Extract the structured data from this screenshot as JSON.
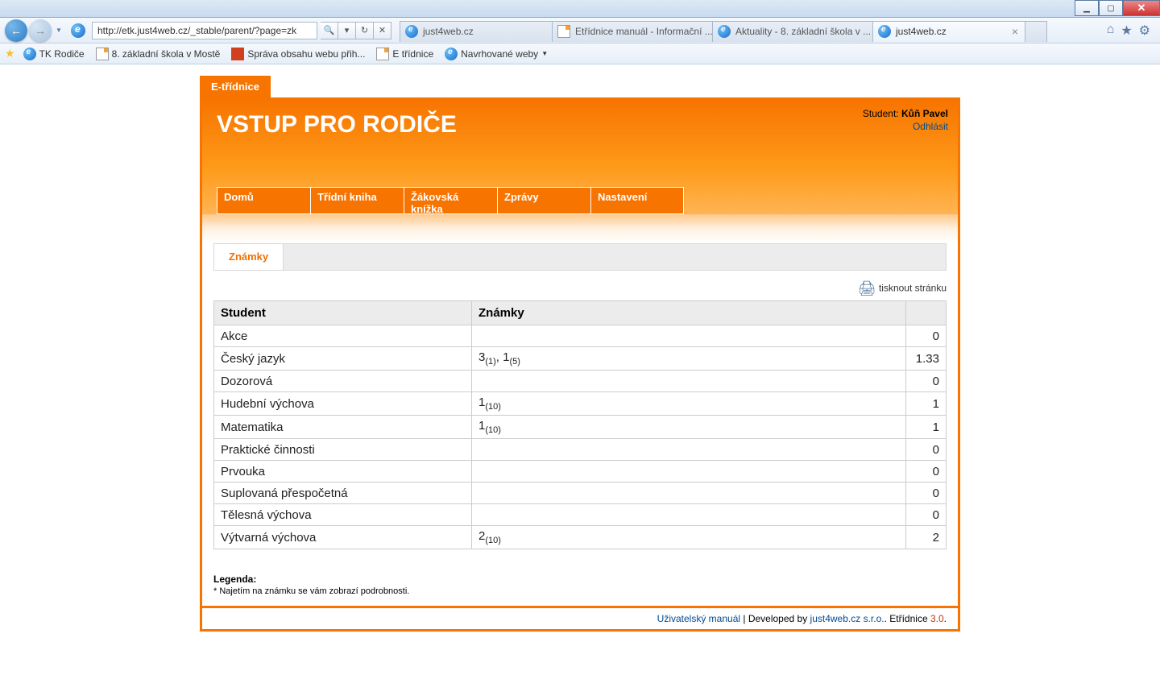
{
  "browser": {
    "url": "http://etk.just4web.cz/_stable/parent/?page=zk",
    "tabs": [
      {
        "label": "just4web.cz",
        "type": "ie",
        "active": false
      },
      {
        "label": "Etřídnice manuál - Informační ...",
        "type": "doc",
        "active": false
      },
      {
        "label": "Aktuality - 8. základní škola v ...",
        "type": "ie",
        "active": false
      },
      {
        "label": "just4web.cz",
        "type": "ie",
        "active": true
      }
    ],
    "bookmarks": [
      {
        "label": "TK Rodiče",
        "type": "ie"
      },
      {
        "label": "8. základní škola v Mostě",
        "type": "doc"
      },
      {
        "label": "Správa obsahu webu  přih...",
        "type": "red"
      },
      {
        "label": "E třídnice",
        "type": "doc"
      },
      {
        "label": "Navrhované weby",
        "type": "ie",
        "dropdown": true
      }
    ]
  },
  "app": {
    "brand_tab": "E-třídnice",
    "title": "VSTUP PRO RODIČE",
    "student_label": "Student:",
    "student_name": "Kůň Pavel",
    "logout": "Odhlásit",
    "nav": [
      {
        "label": "Domů",
        "active": false
      },
      {
        "label": "Třídní kniha",
        "active": false
      },
      {
        "label": "Žákovská knížka",
        "active": true
      },
      {
        "label": "Zprávy",
        "active": false
      },
      {
        "label": "Nastavení",
        "active": false
      }
    ],
    "sub_tab": "Známky",
    "print_label": "tisknout stránku",
    "table": {
      "headers": {
        "student": "Student",
        "grades": "Známky"
      },
      "rows": [
        {
          "subject": "Akce",
          "grades": [],
          "avg": "0"
        },
        {
          "subject": "Český jazyk",
          "grades": [
            {
              "g": "3",
              "w": "(1)"
            },
            {
              "g": "1",
              "w": "(5)"
            }
          ],
          "avg": "1.33"
        },
        {
          "subject": "Dozorová",
          "grades": [],
          "avg": "0"
        },
        {
          "subject": "Hudební výchova",
          "grades": [
            {
              "g": "1",
              "w": "(10)"
            }
          ],
          "avg": "1"
        },
        {
          "subject": "Matematika",
          "grades": [
            {
              "g": "1",
              "w": "(10)"
            }
          ],
          "avg": "1"
        },
        {
          "subject": "Praktické činnosti",
          "grades": [],
          "avg": "0"
        },
        {
          "subject": "Prvouka",
          "grades": [],
          "avg": "0"
        },
        {
          "subject": "Suplovaná přespočetná",
          "grades": [],
          "avg": "0"
        },
        {
          "subject": "Tělesná výchova",
          "grades": [],
          "avg": "0"
        },
        {
          "subject": "Výtvarná výchova",
          "grades": [
            {
              "g": "2",
              "w": "(10)"
            }
          ],
          "avg": "2"
        }
      ]
    },
    "legend": {
      "title": "Legenda:",
      "note": "* Najetím na známku se vám zobrazí podrobnosti."
    },
    "footer": {
      "manual": "Uživatelský manuál",
      "dev": " | Developed by ",
      "company": "just4web.cz s.r.o.",
      "sep": ". ",
      "product": "Etřídnice ",
      "version": "3.0",
      "dot": "."
    }
  }
}
